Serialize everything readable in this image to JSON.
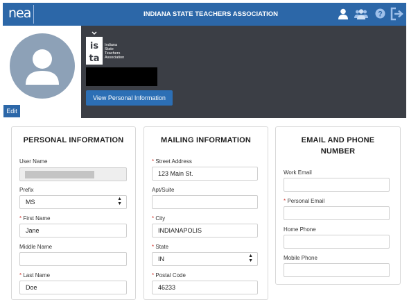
{
  "header": {
    "logo": "nea",
    "title": "INDIANA STATE TEACHERS ASSOCIATION",
    "icons": [
      "user-icon",
      "group-icon",
      "help-icon",
      "logout-icon"
    ]
  },
  "profile": {
    "edit_label": "Edit",
    "brand_short": "isfa",
    "brand_lines": [
      "Indiana",
      "State",
      "Teachers",
      "Association"
    ],
    "view_personal_label": "View Personal Information"
  },
  "personal": {
    "title": "PERSONAL INFORMATION",
    "username_label": "User Name",
    "prefix_label": "Prefix",
    "prefix_value": "MS",
    "first_name_label": "First Name",
    "first_name_value": "Jane",
    "middle_name_label": "Middle Name",
    "middle_name_value": "",
    "last_name_label": "Last Name",
    "last_name_value": "Doe"
  },
  "mailing": {
    "title": "MAILING INFORMATION",
    "street_label": "Street Address",
    "street_value": "123 Main St.",
    "apt_label": "Apt/Suite",
    "apt_value": "",
    "city_label": "City",
    "city_value": "INDIANAPOLIS",
    "state_label": "State",
    "state_value": "IN",
    "postal_label": "Postal Code",
    "postal_value": "46233"
  },
  "contact": {
    "title_line1": "EMAIL AND PHONE",
    "title_line2": "NUMBER",
    "work_email_label": "Work Email",
    "personal_email_label": "Personal Email",
    "home_phone_label": "Home Phone",
    "mobile_phone_label": "Mobile Phone"
  },
  "required_marker": "*",
  "colors": {
    "brand_blue": "#2c67a8",
    "hero_dark": "#3b3e45",
    "required_red": "#d0332b"
  }
}
